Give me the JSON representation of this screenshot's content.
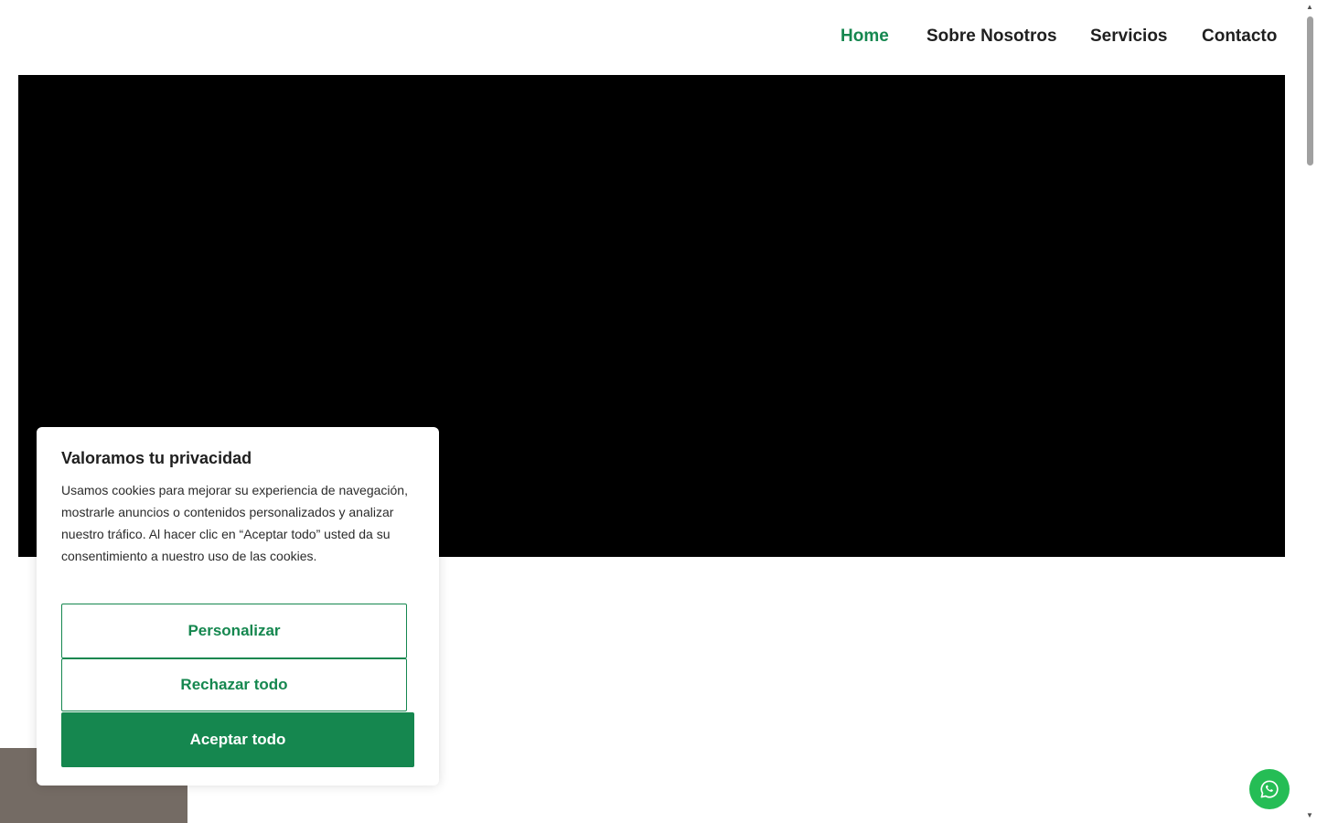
{
  "nav": {
    "items": [
      {
        "label": "Home",
        "active": true
      },
      {
        "label": "Sobre Nosotros",
        "active": false
      },
      {
        "label": "Servicios",
        "active": false
      },
      {
        "label": "Contacto",
        "active": false
      }
    ]
  },
  "cookie": {
    "title": "Valoramos tu privacidad",
    "text": "Usamos cookies para mejorar su experiencia de navegación, mostrarle anuncios o contenidos personalizados y analizar nuestro tráfico. Al hacer clic en “Aceptar todo” usted da su consentimiento a nuestro uso de las cookies.",
    "customize_label": "Personalizar",
    "reject_label": "Rechazar todo",
    "accept_label": "Aceptar todo"
  },
  "whatsapp": {
    "icon": "whatsapp-icon"
  },
  "colors": {
    "accent": "#15874f",
    "whatsapp": "#25bd55",
    "hero": "#000000",
    "block": "#746b64"
  }
}
